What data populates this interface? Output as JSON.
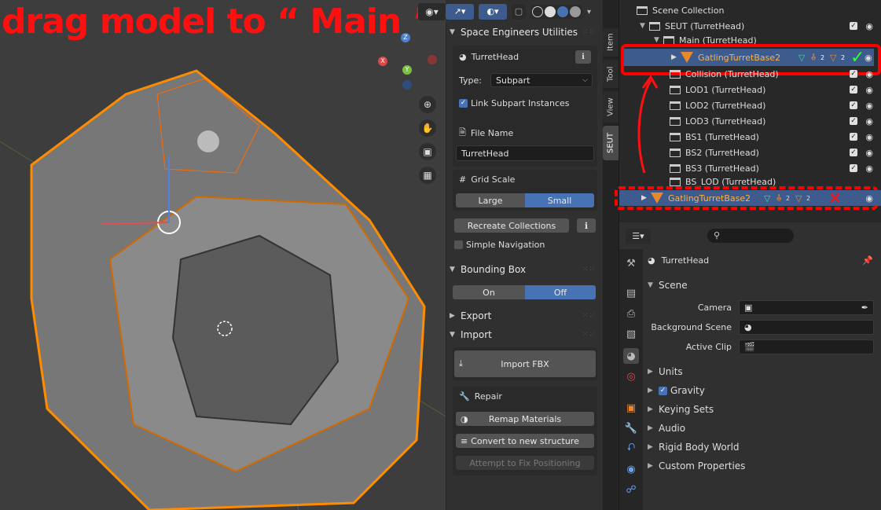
{
  "annotation": {
    "text": "drag model to “ Main ”"
  },
  "npanel": {
    "header": "Space Engineers Utilities",
    "tabs": [
      "Item",
      "Tool",
      "View",
      "SEUT"
    ],
    "scene_name": "TurretHead",
    "type_label": "Type:",
    "type_value": "Subpart",
    "link_subpart": "Link Subpart Instances",
    "file_name_label": "File Name",
    "file_name_value": "TurretHead",
    "grid_scale_label": "Grid Scale",
    "grid_large": "Large",
    "grid_small": "Small",
    "recreate": "Recreate Collections",
    "simple_nav": "Simple Navigation",
    "bbox_label": "Bounding Box",
    "bbox_on": "On",
    "bbox_off": "Off",
    "export_label": "Export",
    "import_label": "Import",
    "import_fbx": "Import FBX",
    "repair_label": "Repair",
    "remap": "Remap Materials",
    "convert": "Convert to new structure",
    "attempt_fix": "Attempt to Fix Positioning",
    "info_icon": "info-icon"
  },
  "outliner": {
    "root": "Scene Collection",
    "seut": "SEUT (TurretHead)",
    "main": "Main (TurretHead)",
    "selected_object": "GatlingTurretBase2",
    "children": [
      "Collision (TurretHead)",
      "LOD1 (TurretHead)",
      "LOD2 (TurretHead)",
      "LOD3 (TurretHead)",
      "BS1 (TurretHead)",
      "BS2 (TurretHead)",
      "BS3 (TurretHead)",
      "BS_LOD (TurretHead)"
    ],
    "bottom_object": "GatlingTurretBase2",
    "badge_count": "2",
    "check_mark": "✓",
    "cross_mark": "✕"
  },
  "properties": {
    "scene_name": "TurretHead",
    "scene_section": "Scene",
    "camera_label": "Camera",
    "background_label": "Background Scene",
    "active_clip_label": "Active Clip",
    "sections": [
      "Units",
      "Gravity",
      "Keying Sets",
      "Audio",
      "Rigid Body World",
      "Custom Properties"
    ]
  },
  "colors": {
    "accent": "#4772b3",
    "annotation_red": "#ff1010",
    "object_orange": "#e8882a"
  }
}
